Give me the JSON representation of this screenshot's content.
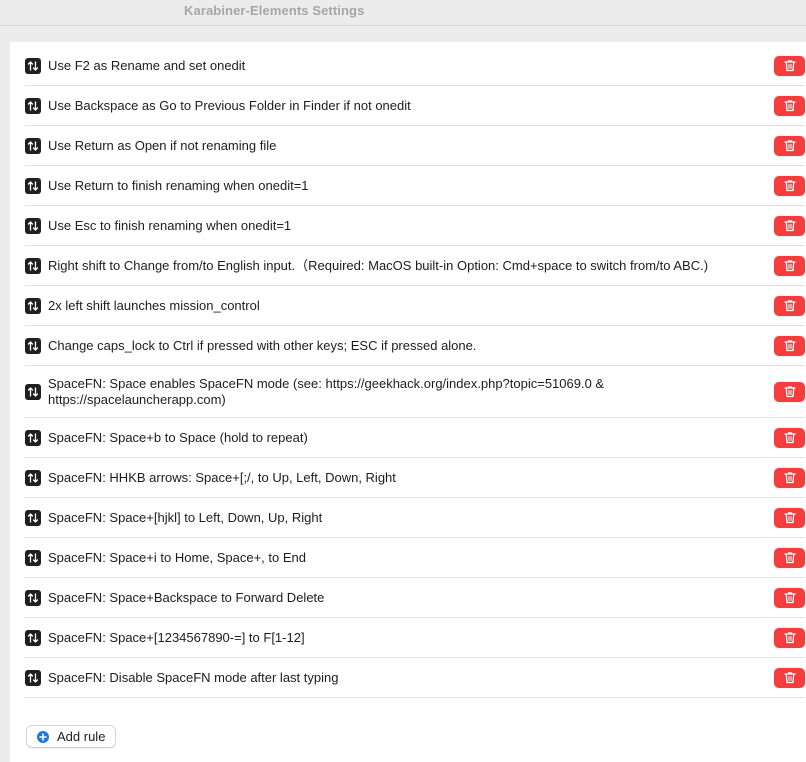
{
  "window": {
    "title": "Karabiner-Elements Settings"
  },
  "rules": [
    "Use F2 as Rename and set onedit",
    "Use Backspace as Go to Previous Folder in Finder if not onedit",
    "Use Return as Open if not renaming file",
    "Use Return to finish renaming when onedit=1",
    "Use Esc to finish renaming when onedit=1",
    "Right shift to Change from/to English input.（Required: MacOS built-in Option:  Cmd+space to switch from/to ABC.)",
    "2x left shift launches mission_control",
    "Change caps_lock to Ctrl if pressed with other keys; ESC if pressed alone.",
    "SpaceFN: Space enables SpaceFN mode (see: https://geekhack.org/index.php?topic=51069.0 & https://spacelauncherapp.com)",
    "SpaceFN: Space+b to Space (hold to repeat)",
    "SpaceFN: HHKB arrows: Space+[;/, to Up, Left, Down, Right",
    "SpaceFN: Space+[hjkl] to Left, Down, Up, Right",
    "SpaceFN: Space+i to Home, Space+, to End",
    "SpaceFN: Space+Backspace to Forward Delete",
    "SpaceFN: Space+[1234567890-=] to F[1-12]",
    "SpaceFN: Disable SpaceFN mode after last typing"
  ],
  "icons": {
    "handle": "up-down-arrows-icon",
    "delete": "trash-icon",
    "add": "plus-circle-icon"
  },
  "colors": {
    "delete_button": "#f53d3d",
    "add_icon": "#1e75e8",
    "window_background": "#ececec",
    "panel_background": "#ffffff"
  },
  "add_button": {
    "label": "Add rule"
  }
}
